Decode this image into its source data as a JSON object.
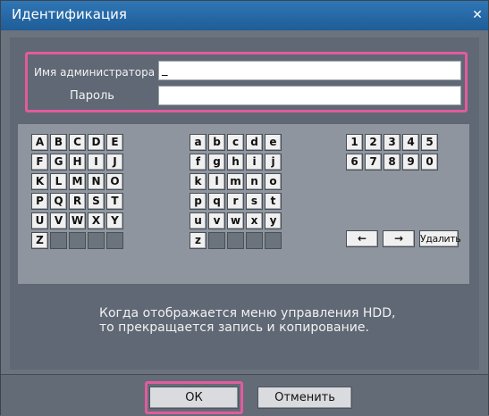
{
  "dialog": {
    "title": "Идентификация",
    "close_icon": "close-icon (×)"
  },
  "credentials": {
    "admin_label": "Имя администратора",
    "admin_value": "_",
    "password_label": "Пароль",
    "password_value": ""
  },
  "keyboard": {
    "upper_rows": [
      [
        "A",
        "B",
        "C",
        "D",
        "E"
      ],
      [
        "F",
        "G",
        "H",
        "I",
        "J"
      ],
      [
        "K",
        "L",
        "M",
        "N",
        "O"
      ],
      [
        "P",
        "Q",
        "R",
        "S",
        "T"
      ],
      [
        "U",
        "V",
        "W",
        "X",
        "Y"
      ],
      [
        "Z",
        "",
        "",
        "",
        ""
      ]
    ],
    "lower_rows": [
      [
        "a",
        "b",
        "c",
        "d",
        "e"
      ],
      [
        "f",
        "g",
        "h",
        "i",
        "j"
      ],
      [
        "k",
        "l",
        "m",
        "n",
        "o"
      ],
      [
        "p",
        "q",
        "r",
        "s",
        "t"
      ],
      [
        "u",
        "v",
        "w",
        "x",
        "y"
      ],
      [
        "z",
        "",
        "",
        "",
        ""
      ]
    ],
    "digit_rows": [
      [
        "1",
        "2",
        "3",
        "4",
        "5"
      ],
      [
        "6",
        "7",
        "8",
        "9",
        "0"
      ]
    ],
    "left_arrow": "←",
    "right_arrow": "→",
    "delete_label": "Удалить"
  },
  "notice": {
    "line1": "Когда отображается меню управления HDD,",
    "line2": "то прекращается запись и копирование."
  },
  "buttons": {
    "ok": "ОК",
    "cancel": "Отменить"
  },
  "colors": {
    "titlebar": "#1f5d97",
    "focus_highlight": "#e25b9e"
  }
}
